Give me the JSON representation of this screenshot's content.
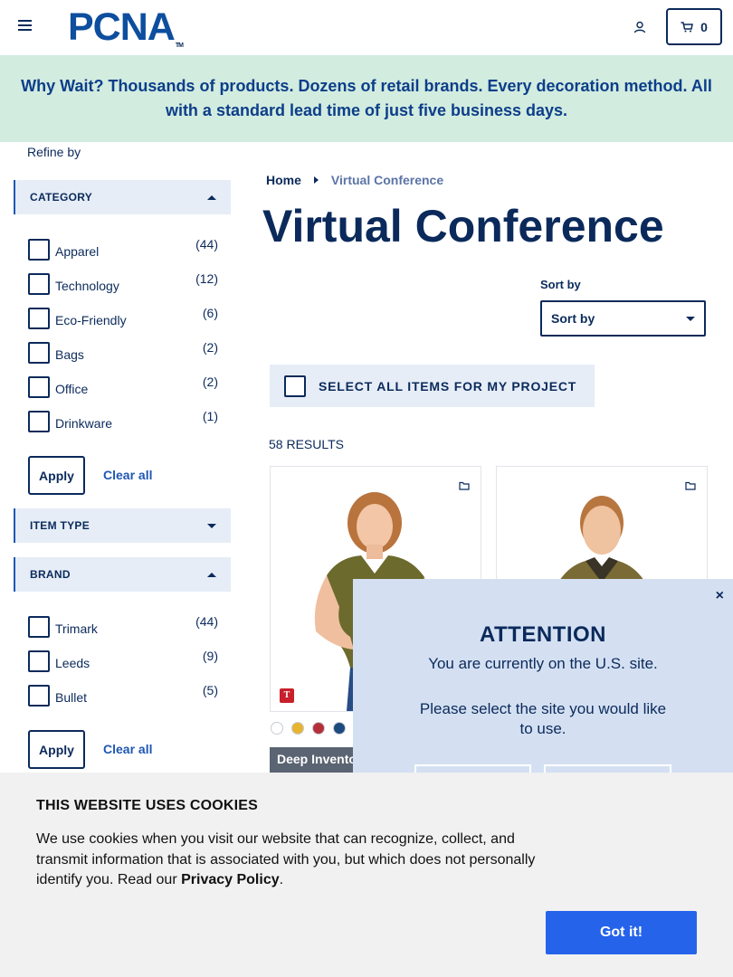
{
  "header": {
    "logo_text": "PCNA",
    "logo_tm": "TM",
    "cart_count": "0"
  },
  "banner": {
    "text": "Why Wait? Thousands of products. Dozens of retail brands. Every decoration method. All with a standard lead time of just five business days."
  },
  "sidebar": {
    "refine_label": "Refine by",
    "category": {
      "title": "CATEGORY",
      "options": [
        {
          "label": "Apparel",
          "count": "(44)"
        },
        {
          "label": "Technology",
          "count": "(12)"
        },
        {
          "label": "Eco-Friendly",
          "count": "(6)"
        },
        {
          "label": "Bags",
          "count": "(2)"
        },
        {
          "label": "Office",
          "count": "(2)"
        },
        {
          "label": "Drinkware",
          "count": "(1)"
        }
      ],
      "apply_label": "Apply",
      "clear_label": "Clear all"
    },
    "item_type": {
      "title": "ITEM TYPE"
    },
    "brand": {
      "title": "BRAND",
      "options": [
        {
          "label": "Trimark",
          "count": "(44)"
        },
        {
          "label": "Leeds",
          "count": "(9)"
        },
        {
          "label": "Bullet",
          "count": "(5)"
        }
      ],
      "apply_label": "Apply",
      "clear_label": "Clear all"
    }
  },
  "main": {
    "breadcrumb_home": "Home",
    "breadcrumb_current": "Virtual Conference",
    "title": "Virtual Conference",
    "sort_label": "Sort by",
    "sort_value": "Sort by",
    "select_all_label": "SELECT ALL ITEMS FOR MY PROJECT",
    "results_count": "58 RESULTS",
    "product1_tag": "Deep Inventory",
    "product1_brand_letter": "T",
    "swatch_colors": [
      "#ffffff",
      "#e8b430",
      "#b3303b",
      "#1d4a7f"
    ]
  },
  "modal": {
    "close": "×",
    "title": "ATTENTION",
    "message1": "You are currently on the U.S. site.",
    "message2": "Please select the site you would like to use."
  },
  "cookie": {
    "title": "THIS WEBSITE USES COOKIES",
    "body": "We use cookies when you visit our website that can recognize, collect, and transmit information that is associated with you, but which does not personally identify you. Read our ",
    "policy_link": "Privacy Policy",
    "period": ".",
    "button": "Got it!"
  },
  "colors": {
    "navy": "#0b2a5b",
    "brand_blue": "#0d4e9e",
    "banner_bg": "#d2ecdf",
    "facet_bg": "#e6edf7",
    "modal_bg": "#d4e0f2",
    "cookie_bg": "#f1f1f1",
    "cta_blue": "#2563eb"
  }
}
